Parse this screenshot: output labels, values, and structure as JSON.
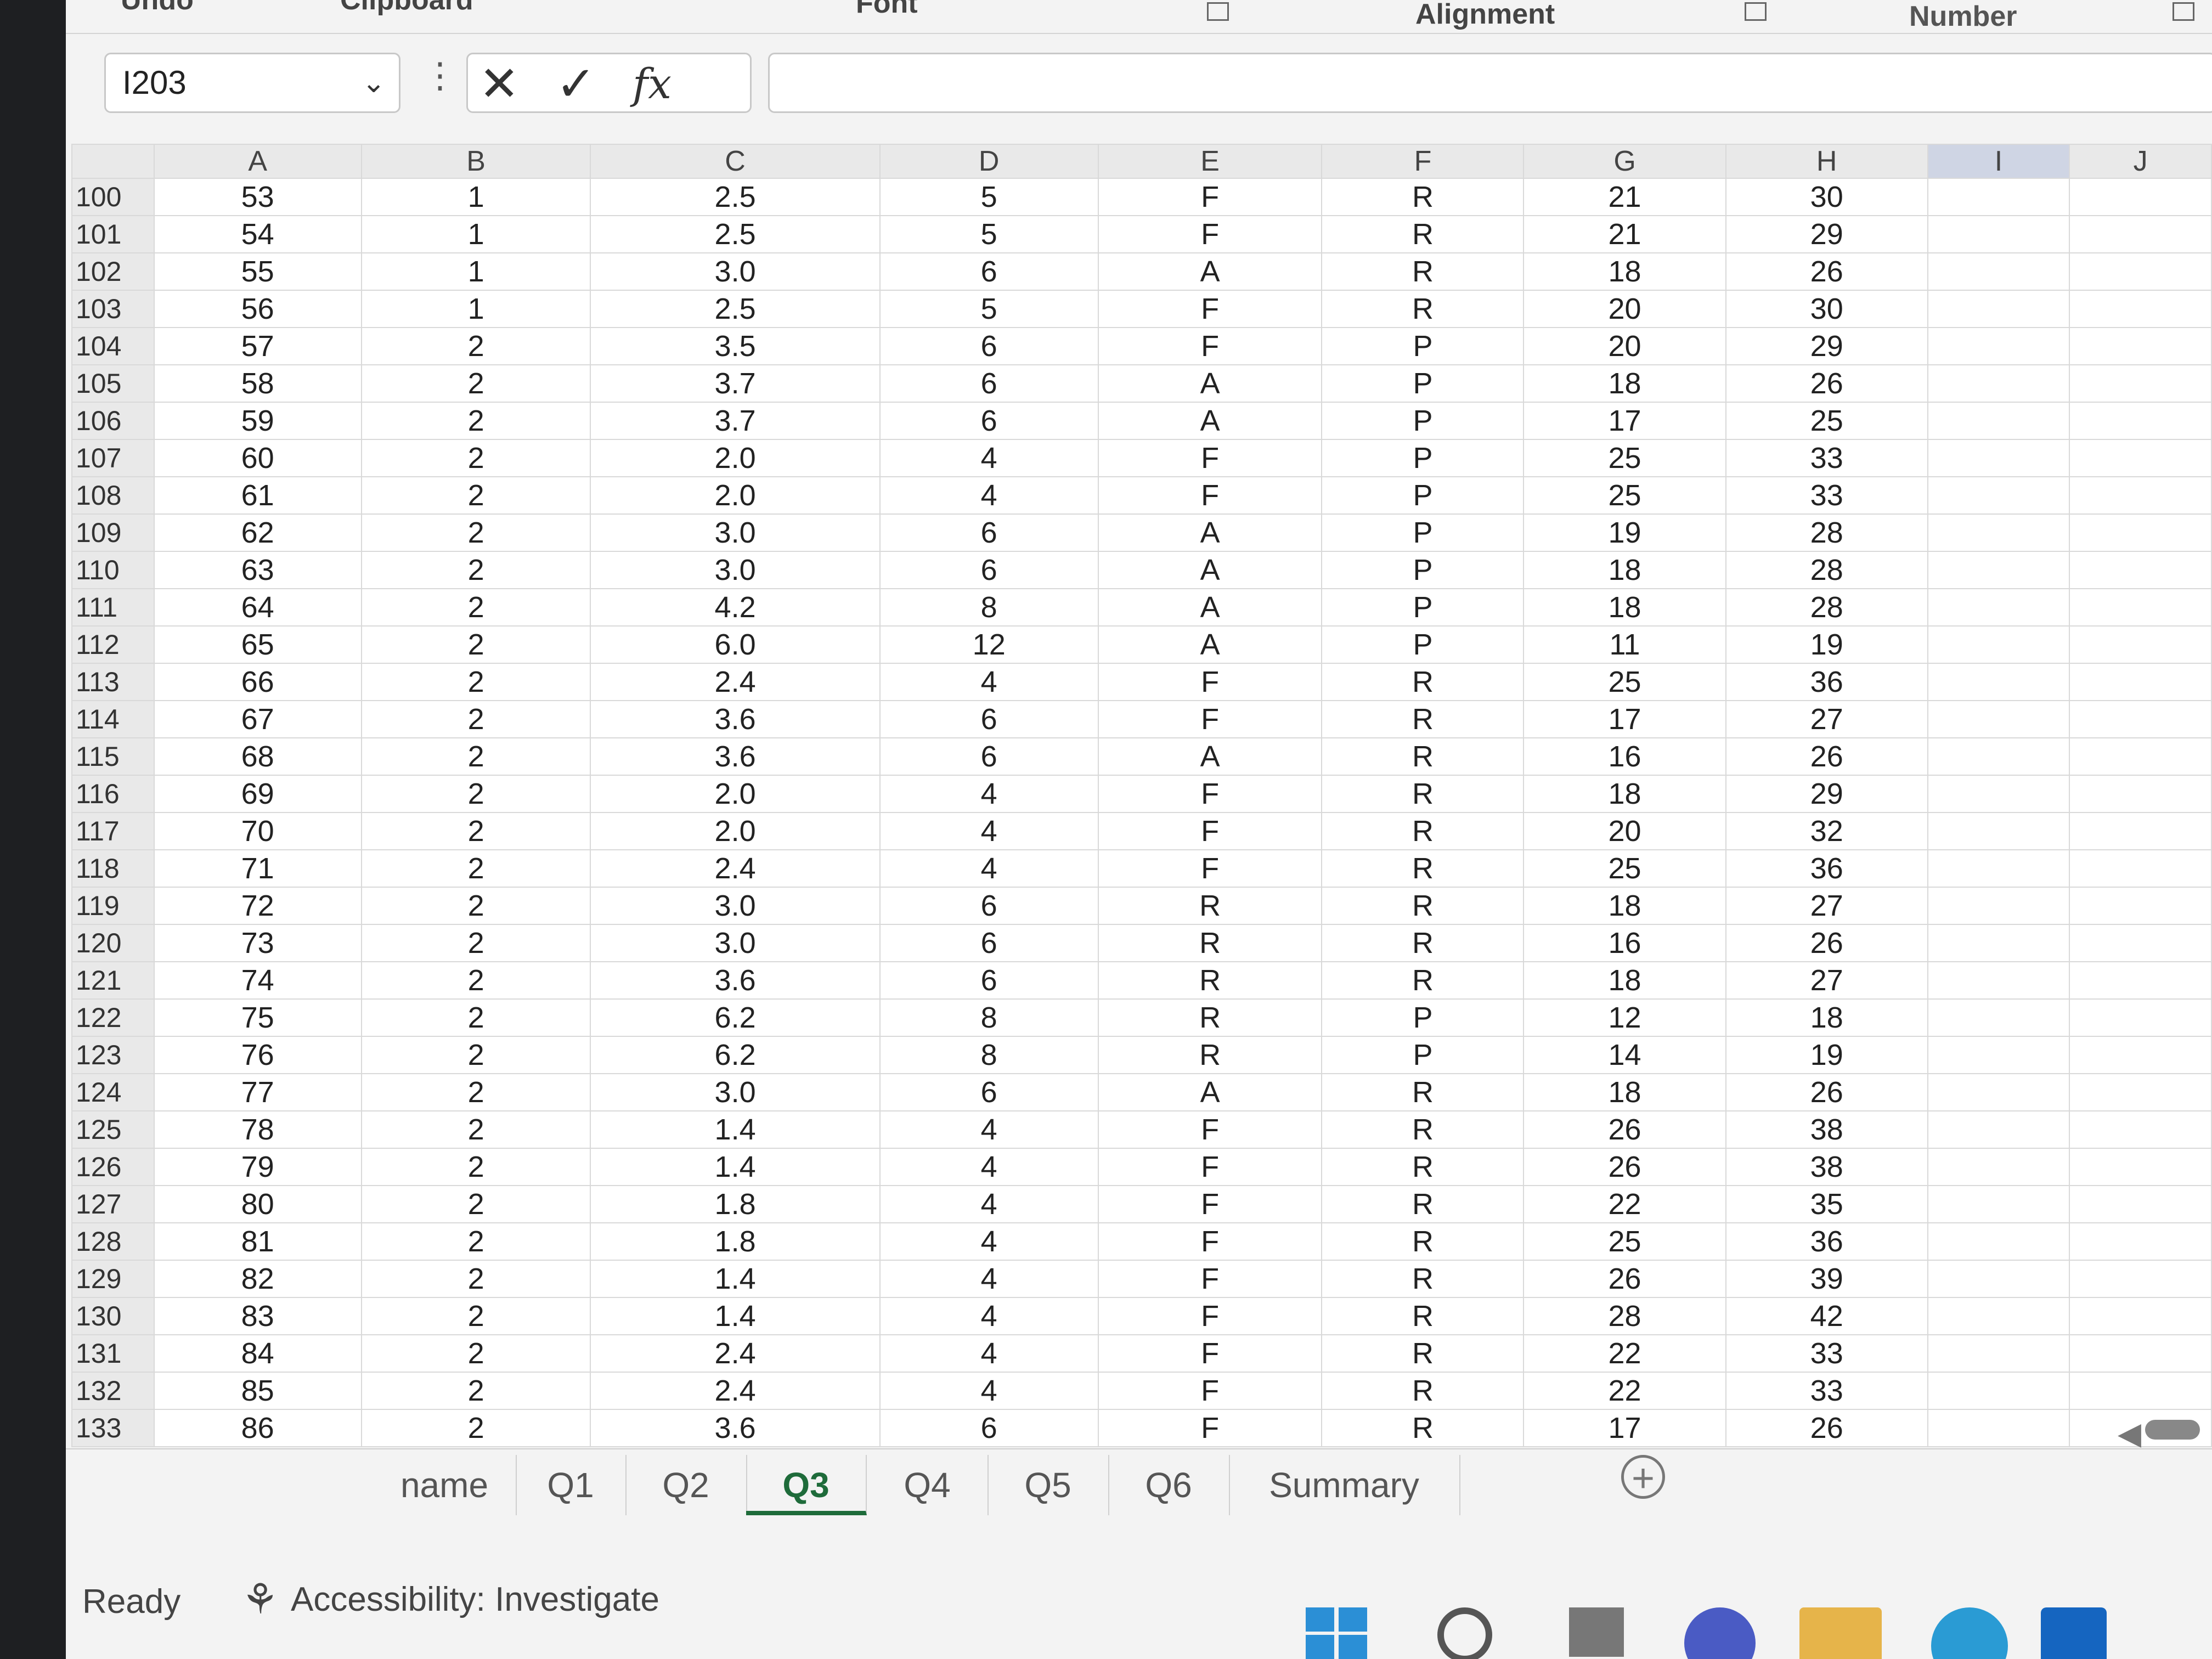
{
  "ribbon": {
    "groups": [
      "Undo",
      "Clipboard",
      "Font",
      "Alignment",
      "Number"
    ]
  },
  "formula_bar": {
    "name_box": "I203",
    "cancel_icon": "✕",
    "enter_icon": "✓",
    "function_icon": "fx",
    "formula_value": ""
  },
  "grid": {
    "column_headers": [
      "A",
      "B",
      "C",
      "D",
      "E",
      "F",
      "G",
      "H",
      "I",
      "J"
    ],
    "rows": [
      {
        "n": "100",
        "c": [
          "53",
          "1",
          "2.5",
          "5",
          "F",
          "R",
          "21",
          "30"
        ]
      },
      {
        "n": "101",
        "c": [
          "54",
          "1",
          "2.5",
          "5",
          "F",
          "R",
          "21",
          "29"
        ]
      },
      {
        "n": "102",
        "c": [
          "55",
          "1",
          "3.0",
          "6",
          "A",
          "R",
          "18",
          "26"
        ]
      },
      {
        "n": "103",
        "c": [
          "56",
          "1",
          "2.5",
          "5",
          "F",
          "R",
          "20",
          "30"
        ]
      },
      {
        "n": "104",
        "c": [
          "57",
          "2",
          "3.5",
          "6",
          "F",
          "P",
          "20",
          "29"
        ]
      },
      {
        "n": "105",
        "c": [
          "58",
          "2",
          "3.7",
          "6",
          "A",
          "P",
          "18",
          "26"
        ]
      },
      {
        "n": "106",
        "c": [
          "59",
          "2",
          "3.7",
          "6",
          "A",
          "P",
          "17",
          "25"
        ]
      },
      {
        "n": "107",
        "c": [
          "60",
          "2",
          "2.0",
          "4",
          "F",
          "P",
          "25",
          "33"
        ]
      },
      {
        "n": "108",
        "c": [
          "61",
          "2",
          "2.0",
          "4",
          "F",
          "P",
          "25",
          "33"
        ]
      },
      {
        "n": "109",
        "c": [
          "62",
          "2",
          "3.0",
          "6",
          "A",
          "P",
          "19",
          "28"
        ]
      },
      {
        "n": "110",
        "c": [
          "63",
          "2",
          "3.0",
          "6",
          "A",
          "P",
          "18",
          "28"
        ]
      },
      {
        "n": "111",
        "c": [
          "64",
          "2",
          "4.2",
          "8",
          "A",
          "P",
          "18",
          "28"
        ]
      },
      {
        "n": "112",
        "c": [
          "65",
          "2",
          "6.0",
          "12",
          "A",
          "P",
          "11",
          "19"
        ]
      },
      {
        "n": "113",
        "c": [
          "66",
          "2",
          "2.4",
          "4",
          "F",
          "R",
          "25",
          "36"
        ]
      },
      {
        "n": "114",
        "c": [
          "67",
          "2",
          "3.6",
          "6",
          "F",
          "R",
          "17",
          "27"
        ]
      },
      {
        "n": "115",
        "c": [
          "68",
          "2",
          "3.6",
          "6",
          "A",
          "R",
          "16",
          "26"
        ]
      },
      {
        "n": "116",
        "c": [
          "69",
          "2",
          "2.0",
          "4",
          "F",
          "R",
          "18",
          "29"
        ]
      },
      {
        "n": "117",
        "c": [
          "70",
          "2",
          "2.0",
          "4",
          "F",
          "R",
          "20",
          "32"
        ]
      },
      {
        "n": "118",
        "c": [
          "71",
          "2",
          "2.4",
          "4",
          "F",
          "R",
          "25",
          "36"
        ]
      },
      {
        "n": "119",
        "c": [
          "72",
          "2",
          "3.0",
          "6",
          "R",
          "R",
          "18",
          "27"
        ]
      },
      {
        "n": "120",
        "c": [
          "73",
          "2",
          "3.0",
          "6",
          "R",
          "R",
          "16",
          "26"
        ]
      },
      {
        "n": "121",
        "c": [
          "74",
          "2",
          "3.6",
          "6",
          "R",
          "R",
          "18",
          "27"
        ]
      },
      {
        "n": "122",
        "c": [
          "75",
          "2",
          "6.2",
          "8",
          "R",
          "P",
          "12",
          "18"
        ]
      },
      {
        "n": "123",
        "c": [
          "76",
          "2",
          "6.2",
          "8",
          "R",
          "P",
          "14",
          "19"
        ]
      },
      {
        "n": "124",
        "c": [
          "77",
          "2",
          "3.0",
          "6",
          "A",
          "R",
          "18",
          "26"
        ]
      },
      {
        "n": "125",
        "c": [
          "78",
          "2",
          "1.4",
          "4",
          "F",
          "R",
          "26",
          "38"
        ]
      },
      {
        "n": "126",
        "c": [
          "79",
          "2",
          "1.4",
          "4",
          "F",
          "R",
          "26",
          "38"
        ]
      },
      {
        "n": "127",
        "c": [
          "80",
          "2",
          "1.8",
          "4",
          "F",
          "R",
          "22",
          "35"
        ]
      },
      {
        "n": "128",
        "c": [
          "81",
          "2",
          "1.8",
          "4",
          "F",
          "R",
          "25",
          "36"
        ]
      },
      {
        "n": "129",
        "c": [
          "82",
          "2",
          "1.4",
          "4",
          "F",
          "R",
          "26",
          "39"
        ]
      },
      {
        "n": "130",
        "c": [
          "83",
          "2",
          "1.4",
          "4",
          "F",
          "R",
          "28",
          "42"
        ]
      },
      {
        "n": "131",
        "c": [
          "84",
          "2",
          "2.4",
          "4",
          "F",
          "R",
          "22",
          "33"
        ]
      },
      {
        "n": "132",
        "c": [
          "85",
          "2",
          "2.4",
          "4",
          "F",
          "R",
          "22",
          "33"
        ]
      },
      {
        "n": "133",
        "c": [
          "86",
          "2",
          "3.6",
          "6",
          "F",
          "R",
          "17",
          "26"
        ]
      }
    ]
  },
  "sheet_tabs": {
    "tabs": [
      "name",
      "Q1",
      "Q2",
      "Q3",
      "Q4",
      "Q5",
      "Q6",
      "Summary"
    ],
    "active": "Q3",
    "active_color": "#1e6b3a",
    "add_icon": "+"
  },
  "status_bar": {
    "ready": "Ready",
    "accessibility": "Accessibility: Investigate"
  },
  "colors": {
    "selected_column_header": "#cfd5e4",
    "gridline": "#d9d9d9"
  },
  "taskbar": {
    "icons": [
      "windows-start-icon",
      "search-icon",
      "task-view-icon",
      "meet-icon",
      "file-explorer-icon",
      "edge-icon",
      "store-icon"
    ]
  }
}
